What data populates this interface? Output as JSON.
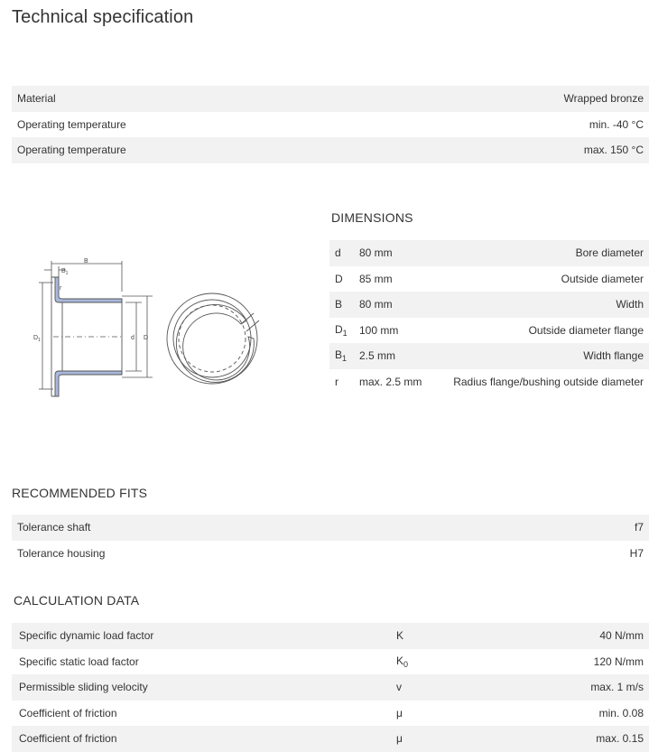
{
  "title": "Technical specification",
  "spec": [
    {
      "label": "Material",
      "value": "Wrapped bronze"
    },
    {
      "label": "Operating temperature",
      "value": "min. -40  °C"
    },
    {
      "label": "Operating temperature",
      "value": "max. 150  °C"
    }
  ],
  "dimensions": {
    "heading": "DIMENSIONS",
    "rows": [
      {
        "sym": "d",
        "sub": "",
        "value": "80  mm",
        "desc": "Bore diameter"
      },
      {
        "sym": "D",
        "sub": "",
        "value": "85  mm",
        "desc": "Outside diameter"
      },
      {
        "sym": "B",
        "sub": "",
        "value": "80  mm",
        "desc": "Width"
      },
      {
        "sym": "D",
        "sub": "1",
        "value": "100  mm",
        "desc": "Outside diameter flange"
      },
      {
        "sym": "B",
        "sub": "1",
        "value": "2.5  mm",
        "desc": "Width flange"
      },
      {
        "sym": "r",
        "sub": "",
        "value": "max. 2.5  mm",
        "desc": "Radius flange/bushing outside diameter"
      }
    ]
  },
  "drawing_labels": {
    "B": "B",
    "B1": "B",
    "B1_sub": "1",
    "r": "r",
    "D1": "D",
    "D1_sub": "1",
    "d": "d",
    "D": "D"
  },
  "fits": {
    "heading": "RECOMMENDED FITS",
    "rows": [
      {
        "label": "Tolerance shaft",
        "value": "f7"
      },
      {
        "label": "Tolerance housing",
        "value": "H7"
      }
    ]
  },
  "calc": {
    "heading": "CALCULATION DATA",
    "rows": [
      {
        "name": "Specific dynamic load factor",
        "sym": "K",
        "sub": "",
        "value": "40  N/mm"
      },
      {
        "name": "Specific static load factor",
        "sym": "K",
        "sub": "0",
        "value": "120  N/mm"
      },
      {
        "name": "Permissible sliding velocity",
        "sym": "v",
        "sub": "",
        "value": "max. 1  m/s"
      },
      {
        "name": "Coefficient of friction",
        "sym": "μ",
        "sub": "",
        "value": "min. 0.08"
      },
      {
        "name": "Coefficient of friction",
        "sym": "μ",
        "sub": "",
        "value": "max. 0.15"
      }
    ]
  }
}
